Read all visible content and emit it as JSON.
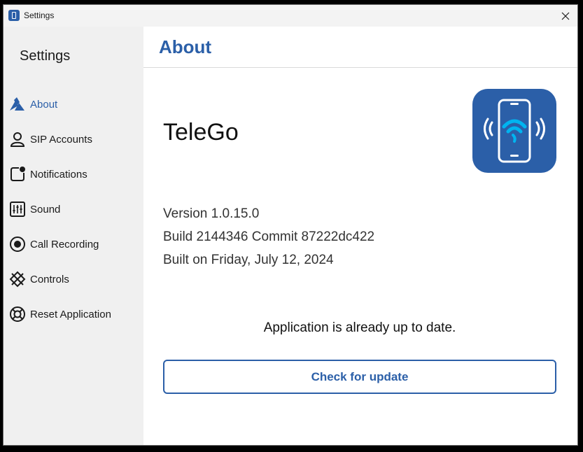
{
  "window": {
    "title": "Settings"
  },
  "sidebar": {
    "title": "Settings",
    "items": [
      {
        "label": "About",
        "icon": "about-icon",
        "active": true
      },
      {
        "label": "SIP Accounts",
        "icon": "user-icon"
      },
      {
        "label": "Notifications",
        "icon": "notification-icon"
      },
      {
        "label": "Sound",
        "icon": "sound-sliders-icon"
      },
      {
        "label": "Call Recording",
        "icon": "record-icon"
      },
      {
        "label": "Controls",
        "icon": "controls-icon"
      },
      {
        "label": "Reset Application",
        "icon": "lifebuoy-icon"
      }
    ]
  },
  "main": {
    "title": "About",
    "app_name": "TeleGo",
    "logo_icon": "phone-signal-icon",
    "version": "Version 1.0.15.0",
    "build": "Build 2144346 Commit 87222dc422",
    "built_on": "Built on Friday, July 12, 2024",
    "status": "Application is already up to date.",
    "update_button": "Check for update"
  },
  "colors": {
    "accent": "#2b5fa8",
    "logo_signal": "#00b4f0",
    "sidebar_bg": "#f0f0f0"
  }
}
